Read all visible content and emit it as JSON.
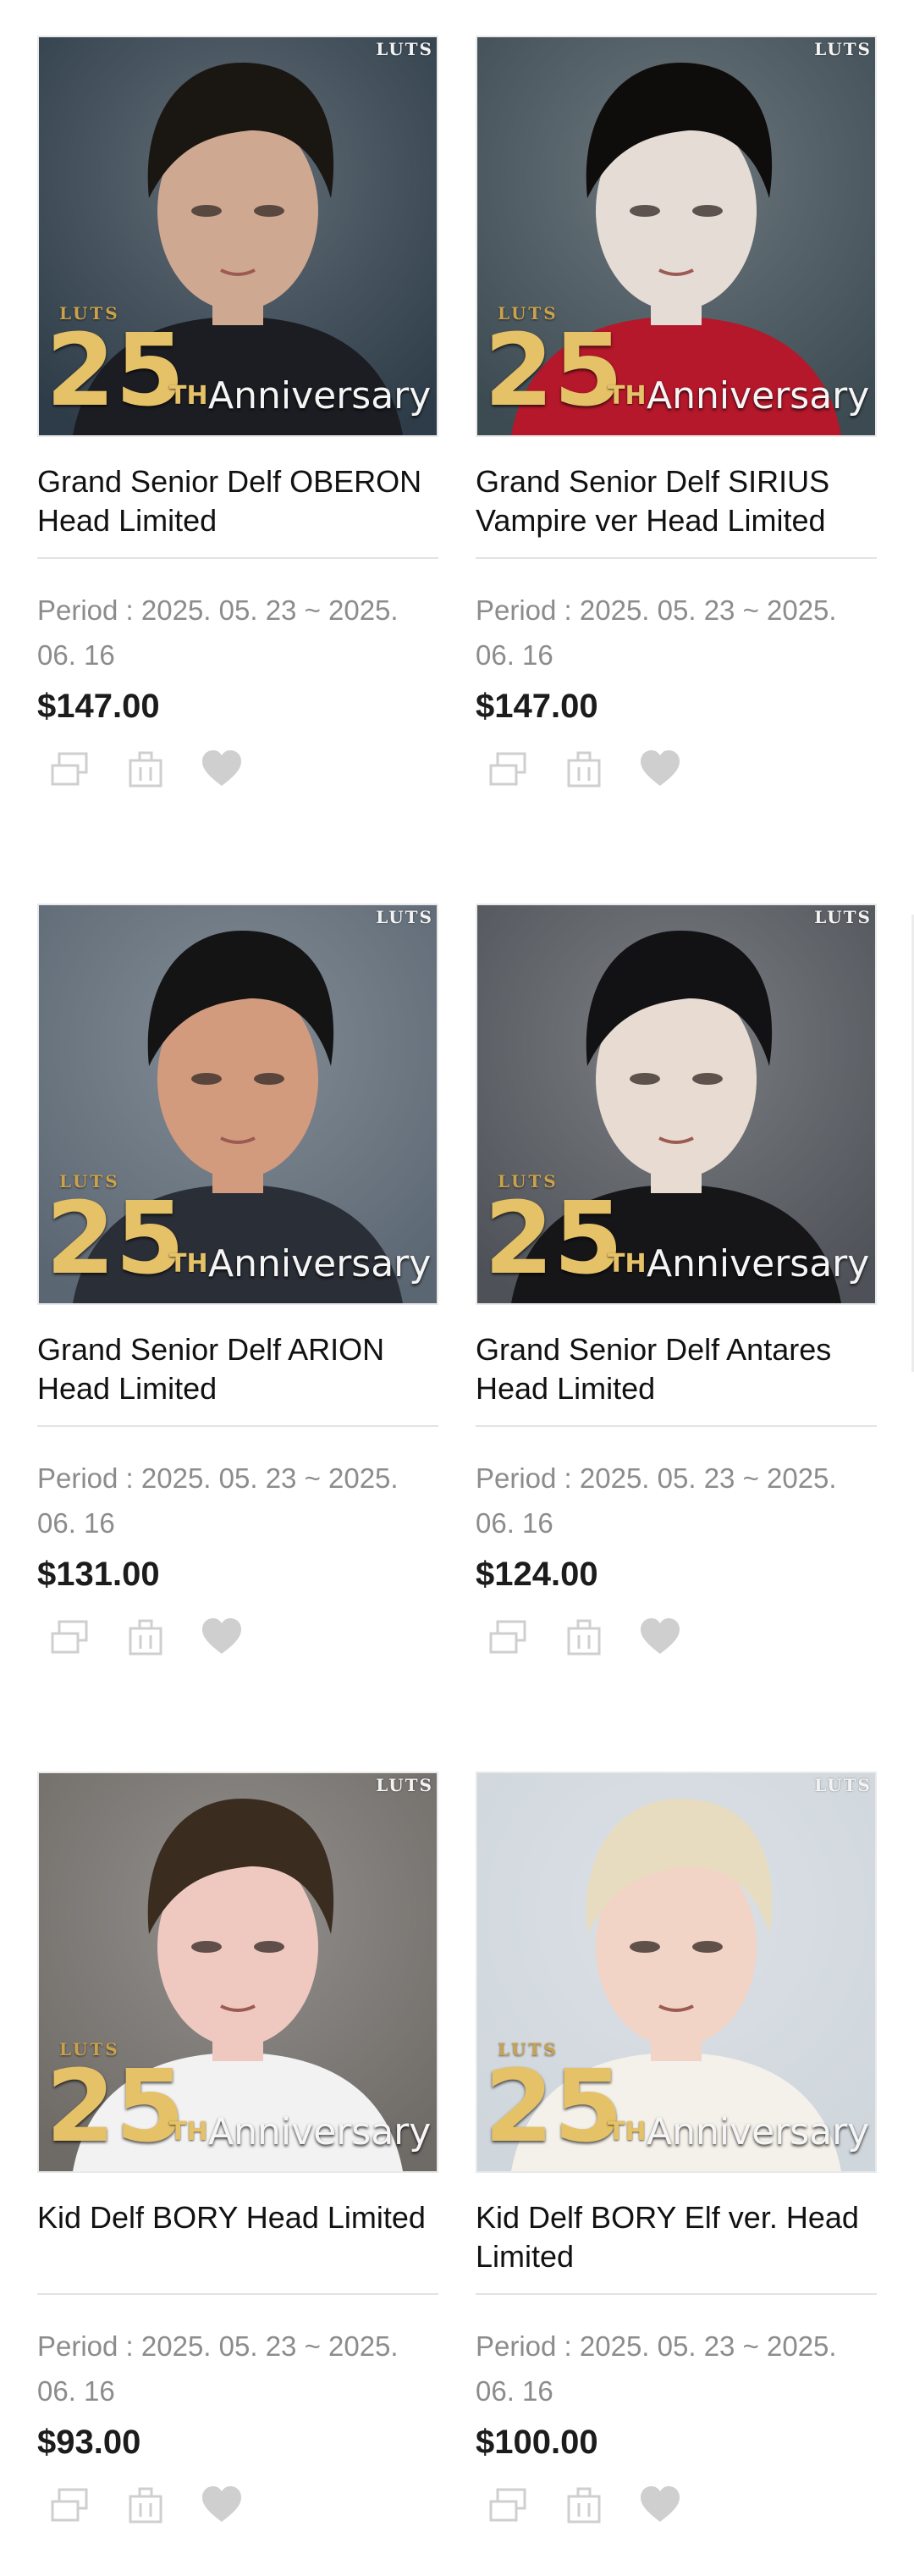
{
  "products": [
    {
      "title": "Grand Senior Delf OBERON Head Limited",
      "period": "Period : 2025. 05. 23 ~ 2025. 06. 16",
      "price": "$147.00",
      "badge": {
        "brand": "LUTS",
        "number": "25",
        "suffix": "TH",
        "word": "Anniversary"
      },
      "image": {
        "bg": "#2d3c48",
        "hair": "#1a1612",
        "skin": "#cfa891",
        "cloth": "#1b1d22"
      }
    },
    {
      "title": "Grand Senior Delf SIRIUS Vampire ver Head Limited",
      "period": "Period : 2025. 05. 23 ~ 2025. 06. 16",
      "price": "$147.00",
      "badge": {
        "brand": "LUTS",
        "number": "25",
        "suffix": "TH",
        "word": "Anniversary"
      },
      "image": {
        "bg": "#3c4a52",
        "hair": "#0f0d0c",
        "skin": "#e6dcd6",
        "cloth": "#b4182a"
      }
    },
    {
      "title": "Grand Senior Delf ARION Head Limited",
      "period": "Period : 2025. 05. 23 ~ 2025. 06. 16",
      "price": "$131.00",
      "badge": {
        "brand": "LUTS",
        "number": "25",
        "suffix": "TH",
        "word": "Anniversary"
      },
      "image": {
        "bg": "#5a6672",
        "hair": "#141414",
        "skin": "#d39b7e",
        "cloth": "#2a2e36"
      }
    },
    {
      "title": "Grand Senior Delf Antares Head Limited",
      "period": "Period : 2025. 05. 23 ~ 2025. 06. 16",
      "price": "$124.00",
      "badge": {
        "brand": "LUTS",
        "number": "25",
        "suffix": "TH",
        "word": "Anniversary"
      },
      "image": {
        "bg": "#4e5258",
        "hair": "#121214",
        "skin": "#e8dcd2",
        "cloth": "#161618"
      }
    },
    {
      "title": "Kid Delf BORY Head Limited",
      "period": "Period : 2025. 05. 23 ~ 2025. 06. 16",
      "price": "$93.00",
      "badge": {
        "brand": "LUTS",
        "number": "25",
        "suffix": "TH",
        "word": "Anniversary"
      },
      "image": {
        "bg": "#6e6a66",
        "hair": "#3b2c20",
        "skin": "#efc9c0",
        "cloth": "#f2f2f2"
      }
    },
    {
      "title": "Kid Delf BORY Elf ver. Head Limited",
      "period": "Period : 2025. 05. 23 ~ 2025. 06. 16",
      "price": "$100.00",
      "badge": {
        "brand": "LUTS",
        "number": "25",
        "suffix": "TH",
        "word": "Anniversary"
      },
      "image": {
        "bg": "#cfd6dc",
        "hair": "#e8dcc0",
        "skin": "#f1d4c6",
        "cloth": "#f4f1ea"
      }
    }
  ],
  "actions": [
    "compare-icon",
    "cart-icon",
    "heart-icon"
  ],
  "colors": {
    "icon": "#cfcfcf",
    "divider": "#e3e3e3",
    "period_text": "#8c8c8c",
    "gold": "#e5c167"
  }
}
